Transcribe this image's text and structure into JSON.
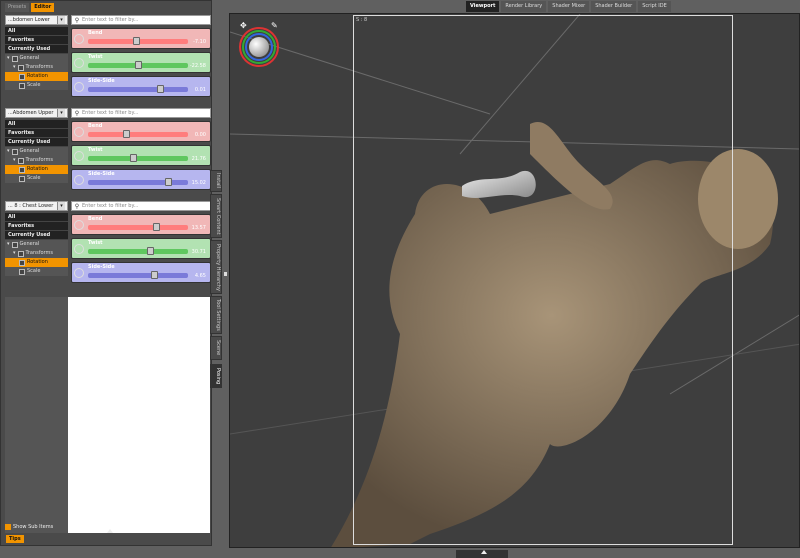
{
  "top_tabs": {
    "presets": "Presets",
    "editor": "Editor"
  },
  "sections": [
    {
      "node": "...bdomen Lower",
      "tree": [
        "All",
        "Favorites",
        "Currently Used"
      ],
      "general": "General",
      "transforms": "Transforms",
      "rotation": "Rotation",
      "scale": "Scale",
      "filter_placeholder": "Enter text to filter by...",
      "sliders": [
        {
          "label": "Bend",
          "value": "-7.10",
          "fraction": 0.48
        },
        {
          "label": "Twist",
          "value": "-22.58",
          "fraction": 0.5
        },
        {
          "label": "Side-Side",
          "value": "0.01",
          "fraction": 0.72
        }
      ]
    },
    {
      "node": "...Abdomen Upper",
      "tree": [
        "All",
        "Favorites",
        "Currently Used"
      ],
      "general": "General",
      "transforms": "Transforms",
      "rotation": "Rotation",
      "scale": "Scale",
      "filter_placeholder": "Enter text to filter by...",
      "sliders": [
        {
          "label": "Bend",
          "value": "0.00",
          "fraction": 0.38
        },
        {
          "label": "Twist",
          "value": "21.76",
          "fraction": 0.45
        },
        {
          "label": "Side-Side",
          "value": "15.02",
          "fraction": 0.8
        }
      ]
    },
    {
      "node": "... 8 : Chest Lower",
      "tree": [
        "All",
        "Favorites",
        "Currently Used"
      ],
      "general": "General",
      "transforms": "Transforms",
      "rotation": "Rotation",
      "scale": "Scale",
      "filter_placeholder": "Enter text to filter by...",
      "sliders": [
        {
          "label": "Bend",
          "value": "13.57",
          "fraction": 0.68
        },
        {
          "label": "Twist",
          "value": "30.71",
          "fraction": 0.62
        },
        {
          "label": "Side-Side",
          "value": "4.65",
          "fraction": 0.66
        }
      ]
    }
  ],
  "show_sub_items": "Show Sub Items",
  "tips": "Tips",
  "side_tabs": [
    "Install",
    "Smart Content",
    "Property Hierarchy",
    "Tool Settings",
    "Scene",
    "Posing"
  ],
  "main_tabs": [
    "Viewport",
    "Render Library",
    "Shader Mixer",
    "Shader Builder",
    "Script IDE"
  ],
  "frame_label": "S : 8"
}
